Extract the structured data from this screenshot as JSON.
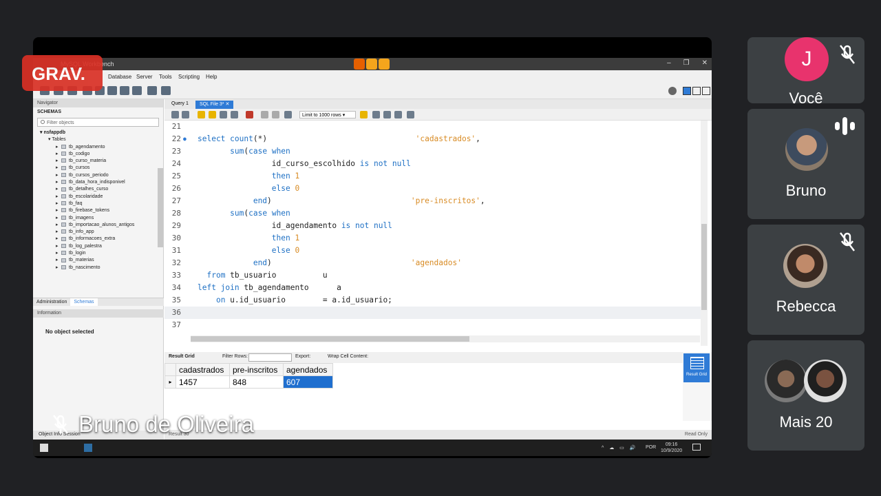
{
  "window": {
    "title": "MySQL Workbench"
  },
  "menu": [
    "Database",
    "Server",
    "Tools",
    "Scripting",
    "Help"
  ],
  "navigator": {
    "header": "Navigator",
    "schemas_label": "SCHEMAS",
    "filter_placeholder": "Filter objects",
    "database": "nsfappdb",
    "tables_label": "Tables",
    "tables": [
      "tb_agendamento",
      "tb_codigo",
      "tb_curso_materia",
      "tb_cursos",
      "tb_cursos_periodo",
      "tb_data_hora_indisponivel",
      "tb_detalhes_curso",
      "tb_escolaridade",
      "tb_faq",
      "tb_firebase_tokens",
      "tb_imagens",
      "tb_importacao_alunos_antigos",
      "tb_info_app",
      "tb_informacoes_extra",
      "tb_log_palestra",
      "tb_login",
      "tb_materias",
      "tb_nascimento"
    ],
    "tab_administration": "Administration",
    "tab_schemas": "Schemas",
    "info_header": "Information",
    "no_object": "No object selected",
    "footer": "Object Info   Session"
  },
  "editor": {
    "tab_query": "Query 1",
    "tab_sql": "SQL File 3*",
    "limit": "Limit to 1000 rows",
    "lines": [
      {
        "n": "21",
        "html": ""
      },
      {
        "n": "22",
        "html": "<span class='kw'>select</span> <span class='fn'>count</span>(*)                                <span class='str'>'cadastrados'</span>,"
      },
      {
        "n": "23",
        "html": "       <span class='fn'>sum</span>(<span class='kw'>case</span> <span class='kw'>when</span>"
      },
      {
        "n": "24",
        "html": "                id_curso_escolhido <span class='kw'>is not null</span>"
      },
      {
        "n": "25",
        "html": "                <span class='kw'>then</span> <span class='num'>1</span>"
      },
      {
        "n": "26",
        "html": "                <span class='kw'>else</span> <span class='num'>0</span>"
      },
      {
        "n": "27",
        "html": "            <span class='kw'>end</span>)                              <span class='str'>'pre-inscritos'</span>,"
      },
      {
        "n": "28",
        "html": "       <span class='fn'>sum</span>(<span class='kw'>case</span> <span class='kw'>when</span>"
      },
      {
        "n": "29",
        "html": "                id_agendamento <span class='kw'>is not null</span>"
      },
      {
        "n": "30",
        "html": "                <span class='kw'>then</span> <span class='num'>1</span>"
      },
      {
        "n": "31",
        "html": "                <span class='kw'>else</span> <span class='num'>0</span>"
      },
      {
        "n": "32",
        "html": "            <span class='kw'>end</span>)                              <span class='str'>'agendados'</span>"
      },
      {
        "n": "33",
        "html": "  <span class='kw'>from</span> tb_usuario          u"
      },
      {
        "n": "34",
        "html": "<span class='kw'>left join</span> tb_agendamento      a"
      },
      {
        "n": "35",
        "html": "    <span class='kw'>on</span> u.id_usuario        = a.id_usuario;"
      },
      {
        "n": "36",
        "html": ""
      },
      {
        "n": "37",
        "html": ""
      }
    ]
  },
  "results": {
    "toolbar_result_grid": "Result Grid",
    "toolbar_filter": "Filter Rows:",
    "toolbar_export": "Export:",
    "toolbar_wrap": "Wrap Cell Content:",
    "columns": [
      "cadastrados",
      "pre-inscritos",
      "agendados"
    ],
    "row": [
      "1457",
      "848",
      "607"
    ],
    "side_btn": "Result Grid",
    "tab": "Result 30",
    "read_only": "Read Only"
  },
  "taskbar": {
    "lang": "POR",
    "time": "09:16",
    "date": "10/9/2020"
  },
  "meeting": {
    "recording_badge": "GRAV.",
    "presenter_name": "Bruno de Oliveira",
    "participants": [
      {
        "name": "Você",
        "initial": "J"
      },
      {
        "name": "Bruno"
      },
      {
        "name": "Rebecca"
      },
      {
        "name": "Mais 20"
      }
    ]
  },
  "colors": {
    "accent": "#2f7bd6",
    "recording": "#d93025",
    "avatar": "#e8336d",
    "tile_bg": "#3c4043"
  }
}
